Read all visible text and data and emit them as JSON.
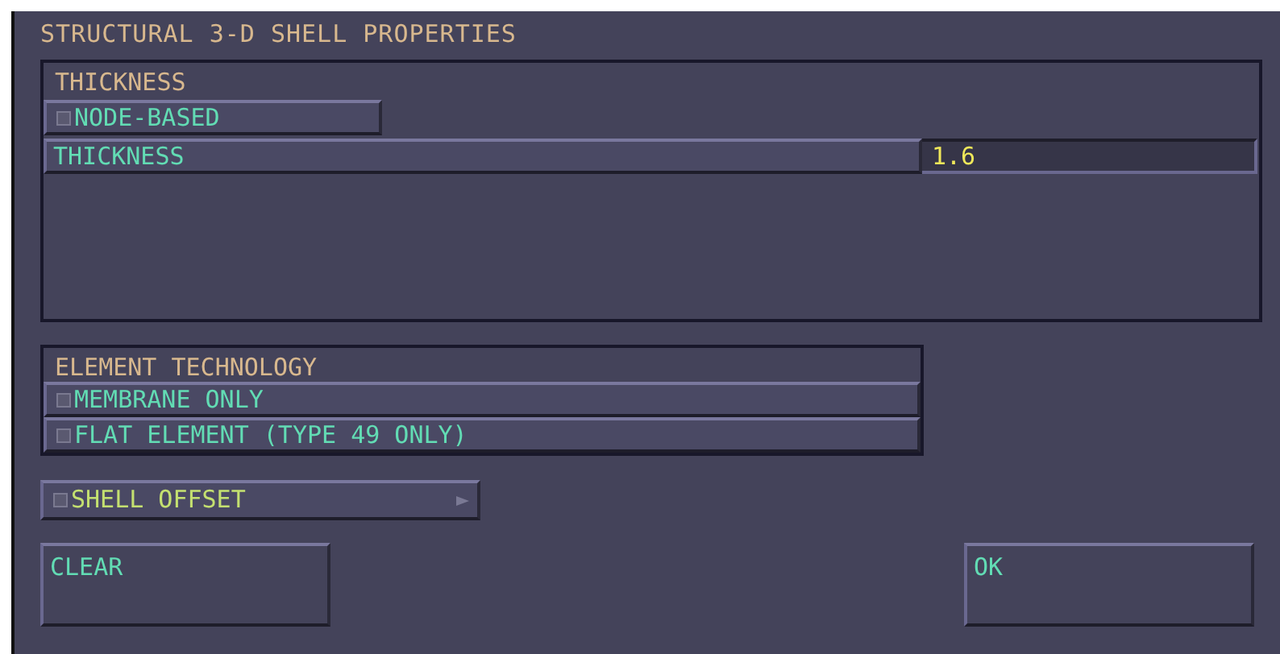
{
  "window": {
    "title": "STRUCTURAL 3-D SHELL PROPERTIES"
  },
  "thickness_group": {
    "title": "THICKNESS",
    "node_based": {
      "label": "NODE-BASED",
      "checked": false
    },
    "thickness_field": {
      "label": "THICKNESS",
      "value": "1.6"
    }
  },
  "element_technology": {
    "title": "ELEMENT TECHNOLOGY",
    "options": [
      {
        "label": "MEMBRANE ONLY",
        "checked": false
      },
      {
        "label": "FLAT ELEMENT (TYPE 49 ONLY)",
        "checked": false
      }
    ]
  },
  "shell_offset": {
    "label": "SHELL OFFSET",
    "checked": false
  },
  "buttons": [
    {
      "label": "CLEAR"
    },
    {
      "label": "OK"
    }
  ]
}
